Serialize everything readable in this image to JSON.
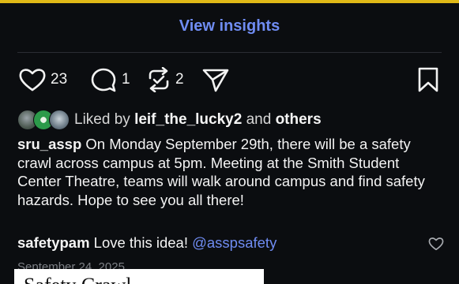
{
  "insights_label": "View insights",
  "actions": {
    "like_count": "23",
    "comment_count": "1",
    "repost_count": "2"
  },
  "likes": {
    "prefix": "Liked by",
    "user": "leif_the_lucky2",
    "and": "and",
    "others": "others"
  },
  "post": {
    "username": "sru_assp",
    "text": "On Monday September 29th, there will be a safety crawl across campus at 5pm. Meeting at the Smith Student Center Theatre, teams will walk around campus and find safety hazards. Hope to see you all there!"
  },
  "comment": {
    "username": "safetypam",
    "text": "Love this idea!",
    "mention": "@asspsafety"
  },
  "date": "September 24, 2025",
  "overlay_text": "Safety Crawl",
  "colors": {
    "accent_link": "#6f8cf2",
    "top_bar": "#e0b917",
    "background": "#0b0d10"
  }
}
